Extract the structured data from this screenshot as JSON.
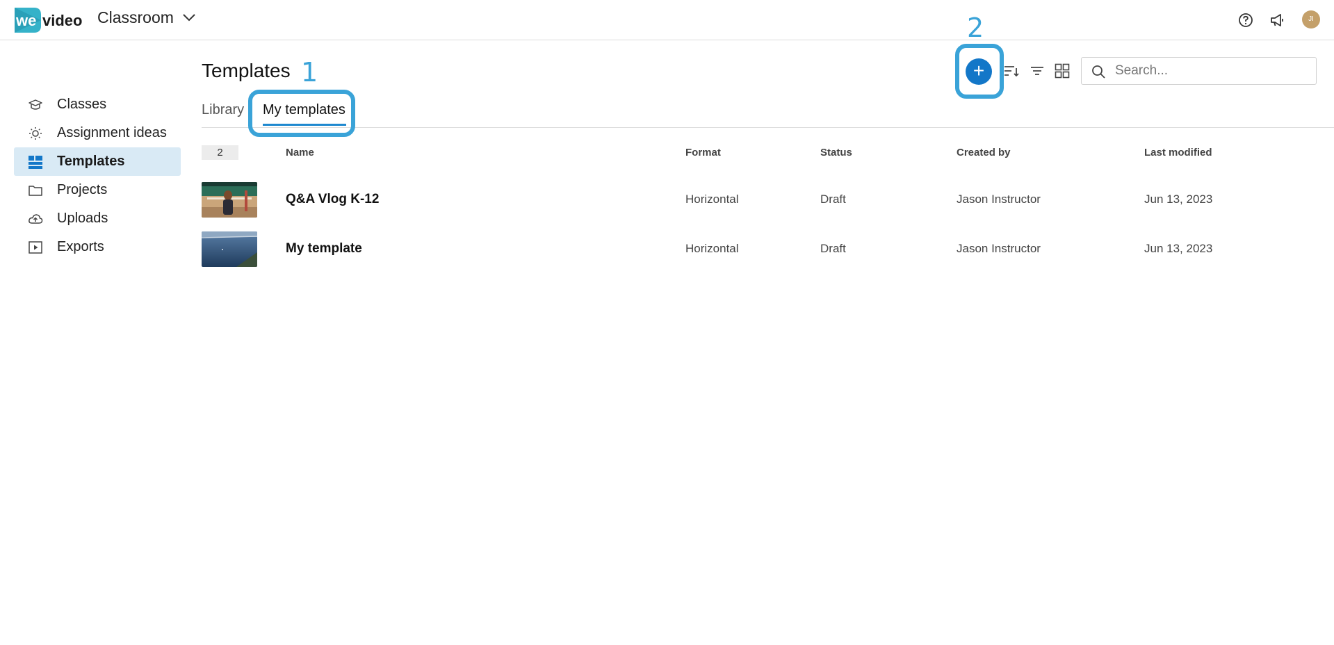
{
  "header": {
    "logo_text": "wevideo",
    "workspace": "Classroom",
    "avatar_initials": "JI"
  },
  "sidebar": {
    "items": [
      {
        "label": "Classes",
        "icon": "graduation-cap-icon"
      },
      {
        "label": "Assignment ideas",
        "icon": "lightbulb-icon"
      },
      {
        "label": "Templates",
        "icon": "templates-icon"
      },
      {
        "label": "Projects",
        "icon": "folder-icon"
      },
      {
        "label": "Uploads",
        "icon": "cloud-upload-icon"
      },
      {
        "label": "Exports",
        "icon": "play-box-icon"
      }
    ],
    "active": "Templates"
  },
  "main": {
    "title": "Templates",
    "tabs": [
      {
        "label": "Library"
      },
      {
        "label": "My templates"
      }
    ],
    "callouts": [
      "1",
      "2"
    ],
    "search_placeholder": "Search...",
    "count": "2",
    "columns": {
      "name": "Name",
      "format": "Format",
      "status": "Status",
      "created_by": "Created by",
      "last_modified": "Last modified"
    },
    "rows": [
      {
        "name": "Q&A Vlog K-12",
        "format": "Horizontal",
        "status": "Draft",
        "created_by": "Jason Instructor",
        "last_modified": "Jun 13, 2023"
      },
      {
        "name": "My template",
        "format": "Horizontal",
        "status": "Draft",
        "created_by": "Jason Instructor",
        "last_modified": "Jun 13, 2023"
      }
    ]
  },
  "colors": {
    "accent": "#1377c8",
    "callout": "#3aa3d8",
    "active_nav_bg": "#d9eaf5",
    "avatar": "#c4a06a"
  }
}
